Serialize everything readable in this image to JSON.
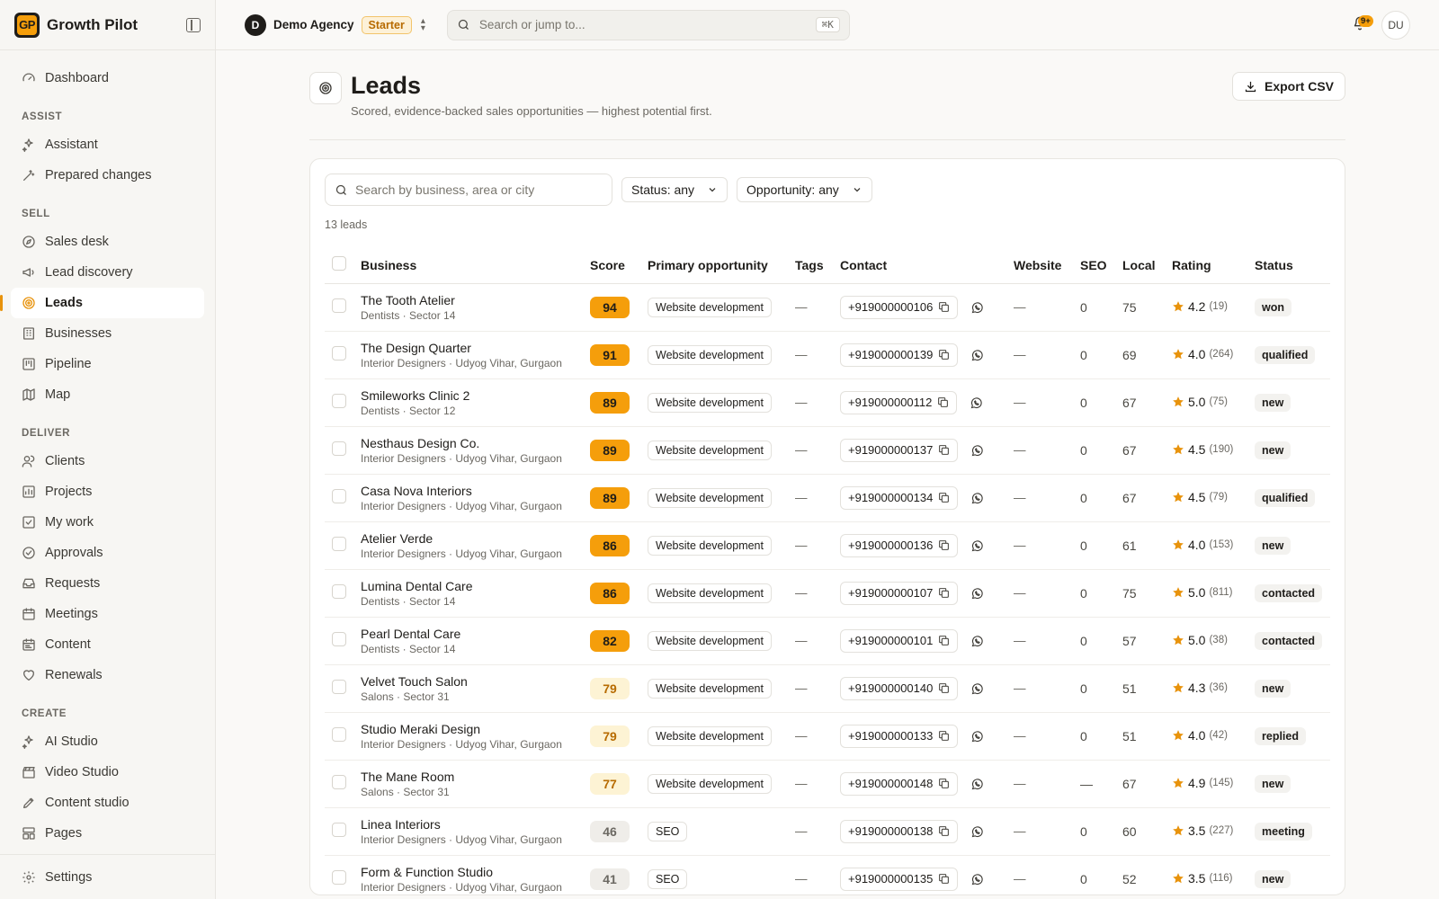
{
  "app": {
    "logo_text": "GP",
    "name": "Growth Pilot"
  },
  "sidebar": {
    "top": [
      {
        "label": "Dashboard",
        "icon": "gauge-icon"
      }
    ],
    "sections": [
      {
        "label": "ASSIST",
        "items": [
          {
            "label": "Assistant",
            "icon": "sparkles-icon"
          },
          {
            "label": "Prepared changes",
            "icon": "wand-icon"
          }
        ]
      },
      {
        "label": "SELL",
        "items": [
          {
            "label": "Sales desk",
            "icon": "compass-icon"
          },
          {
            "label": "Lead discovery",
            "icon": "megaphone-icon"
          },
          {
            "label": "Leads",
            "icon": "target-icon",
            "active": true
          },
          {
            "label": "Businesses",
            "icon": "building-icon"
          },
          {
            "label": "Pipeline",
            "icon": "kanban-icon"
          },
          {
            "label": "Map",
            "icon": "map-icon"
          }
        ]
      },
      {
        "label": "DELIVER",
        "items": [
          {
            "label": "Clients",
            "icon": "users-icon"
          },
          {
            "label": "Projects",
            "icon": "chart-icon"
          },
          {
            "label": "My work",
            "icon": "check-square-icon"
          },
          {
            "label": "Approvals",
            "icon": "check-circle-icon"
          },
          {
            "label": "Requests",
            "icon": "inbox-icon"
          },
          {
            "label": "Meetings",
            "icon": "calendar-icon"
          },
          {
            "label": "Content",
            "icon": "calendar-text-icon"
          },
          {
            "label": "Renewals",
            "icon": "heart-icon"
          }
        ]
      },
      {
        "label": "CREATE",
        "items": [
          {
            "label": "AI Studio",
            "icon": "sparkles-icon"
          },
          {
            "label": "Video Studio",
            "icon": "clapper-icon"
          },
          {
            "label": "Content studio",
            "icon": "pen-icon"
          },
          {
            "label": "Pages",
            "icon": "layout-icon"
          }
        ]
      }
    ],
    "footer": {
      "label": "Settings",
      "icon": "gear-icon"
    }
  },
  "topbar": {
    "workspace_initial": "D",
    "workspace_name": "Demo Agency",
    "plan": "Starter",
    "search_placeholder": "Search or jump to...",
    "search_shortcut": "⌘K",
    "notifications_badge": "9+",
    "user_initials": "DU"
  },
  "page": {
    "title": "Leads",
    "subtitle": "Scored, evidence-backed sales opportunities — highest potential first.",
    "export_label": "Export CSV"
  },
  "filters": {
    "search_placeholder": "Search by business, area or city",
    "status_label": "Status: any",
    "opportunity_label": "Opportunity: any",
    "count_text": "13 leads"
  },
  "table": {
    "columns": [
      "Business",
      "Score",
      "Primary opportunity",
      "Tags",
      "Contact",
      "Website",
      "SEO",
      "Local",
      "Rating",
      "Status"
    ],
    "rows": [
      {
        "name": "The Tooth Atelier",
        "sub": "Dentists · Sector 14",
        "score": 94,
        "tier": "hi",
        "opp": "Website development",
        "tags": "—",
        "phone": "+919000000106",
        "website": "—",
        "seo": "0",
        "local": "75",
        "rating": "4.2",
        "reviews": "(19)",
        "status": "won"
      },
      {
        "name": "The Design Quarter",
        "sub": "Interior Designers · Udyog Vihar, Gurgaon",
        "score": 91,
        "tier": "hi",
        "opp": "Website development",
        "tags": "—",
        "phone": "+919000000139",
        "website": "—",
        "seo": "0",
        "local": "69",
        "rating": "4.0",
        "reviews": "(264)",
        "status": "qualified"
      },
      {
        "name": "Smileworks Clinic 2",
        "sub": "Dentists · Sector 12",
        "score": 89,
        "tier": "hi",
        "opp": "Website development",
        "tags": "—",
        "phone": "+919000000112",
        "website": "—",
        "seo": "0",
        "local": "67",
        "rating": "5.0",
        "reviews": "(75)",
        "status": "new"
      },
      {
        "name": "Nesthaus Design Co.",
        "sub": "Interior Designers · Udyog Vihar, Gurgaon",
        "score": 89,
        "tier": "hi",
        "opp": "Website development",
        "tags": "—",
        "phone": "+919000000137",
        "website": "—",
        "seo": "0",
        "local": "67",
        "rating": "4.5",
        "reviews": "(190)",
        "status": "new"
      },
      {
        "name": "Casa Nova Interiors",
        "sub": "Interior Designers · Udyog Vihar, Gurgaon",
        "score": 89,
        "tier": "hi",
        "opp": "Website development",
        "tags": "—",
        "phone": "+919000000134",
        "website": "—",
        "seo": "0",
        "local": "67",
        "rating": "4.5",
        "reviews": "(79)",
        "status": "qualified"
      },
      {
        "name": "Atelier Verde",
        "sub": "Interior Designers · Udyog Vihar, Gurgaon",
        "score": 86,
        "tier": "hi",
        "opp": "Website development",
        "tags": "—",
        "phone": "+919000000136",
        "website": "—",
        "seo": "0",
        "local": "61",
        "rating": "4.0",
        "reviews": "(153)",
        "status": "new"
      },
      {
        "name": "Lumina Dental Care",
        "sub": "Dentists · Sector 14",
        "score": 86,
        "tier": "hi",
        "opp": "Website development",
        "tags": "—",
        "phone": "+919000000107",
        "website": "—",
        "seo": "0",
        "local": "75",
        "rating": "5.0",
        "reviews": "(811)",
        "status": "contacted"
      },
      {
        "name": "Pearl Dental Care",
        "sub": "Dentists · Sector 14",
        "score": 82,
        "tier": "hi",
        "opp": "Website development",
        "tags": "—",
        "phone": "+919000000101",
        "website": "—",
        "seo": "0",
        "local": "57",
        "rating": "5.0",
        "reviews": "(38)",
        "status": "contacted"
      },
      {
        "name": "Velvet Touch Salon",
        "sub": "Salons · Sector 31",
        "score": 79,
        "tier": "mid",
        "opp": "Website development",
        "tags": "—",
        "phone": "+919000000140",
        "website": "—",
        "seo": "0",
        "local": "51",
        "rating": "4.3",
        "reviews": "(36)",
        "status": "new"
      },
      {
        "name": "Studio Meraki Design",
        "sub": "Interior Designers · Udyog Vihar, Gurgaon",
        "score": 79,
        "tier": "mid",
        "opp": "Website development",
        "tags": "—",
        "phone": "+919000000133",
        "website": "—",
        "seo": "0",
        "local": "51",
        "rating": "4.0",
        "reviews": "(42)",
        "status": "replied"
      },
      {
        "name": "The Mane Room",
        "sub": "Salons · Sector 31",
        "score": 77,
        "tier": "mid",
        "opp": "Website development",
        "tags": "—",
        "phone": "+919000000148",
        "website": "—",
        "seo": "—",
        "local": "67",
        "rating": "4.9",
        "reviews": "(145)",
        "status": "new"
      },
      {
        "name": "Linea Interiors",
        "sub": "Interior Designers · Udyog Vihar, Gurgaon",
        "score": 46,
        "tier": "lo",
        "opp": "SEO",
        "tags": "—",
        "phone": "+919000000138",
        "website": "—",
        "seo": "0",
        "local": "60",
        "rating": "3.5",
        "reviews": "(227)",
        "status": "meeting"
      },
      {
        "name": "Form & Function Studio",
        "sub": "Interior Designers · Udyog Vihar, Gurgaon",
        "score": 41,
        "tier": "lo",
        "opp": "SEO",
        "tags": "—",
        "phone": "+919000000135",
        "website": "—",
        "seo": "0",
        "local": "52",
        "rating": "3.5",
        "reviews": "(116)",
        "status": "new"
      }
    ]
  }
}
